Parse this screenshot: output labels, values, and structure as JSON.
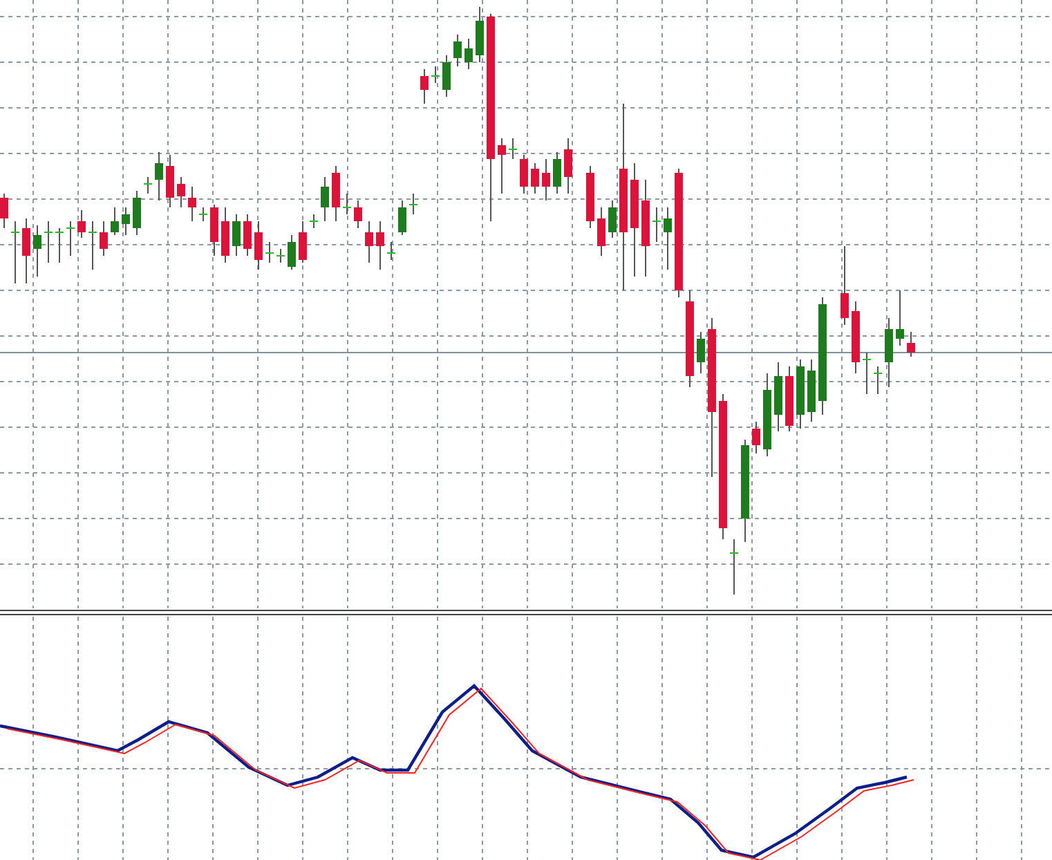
{
  "panes": [
    {
      "kind": "candlestick"
    },
    {
      "kind": "oscillator"
    }
  ]
}
